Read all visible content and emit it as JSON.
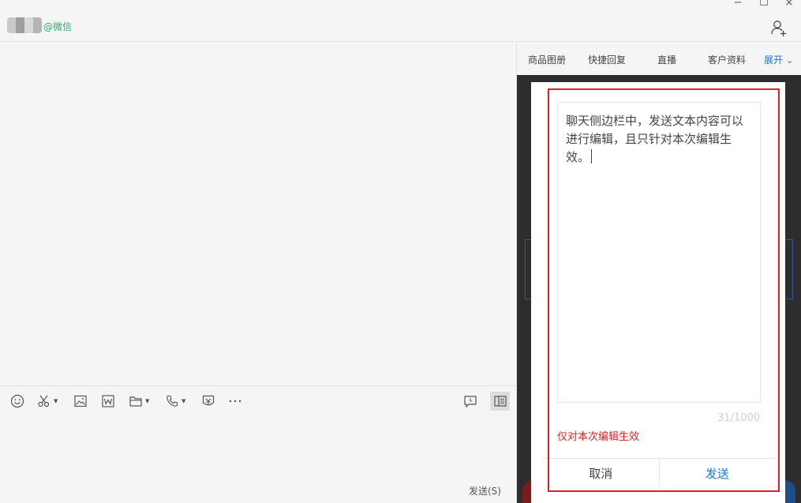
{
  "header": {
    "platform_tag": "@微信",
    "window_controls": {
      "minimize": "−",
      "maximize": "☐",
      "close": "×"
    }
  },
  "toolbar": {
    "icons": [
      "emoji-icon",
      "scissors-icon",
      "image-icon",
      "word-doc-icon",
      "folder-icon",
      "phone-icon",
      "red-packet-icon",
      "more-icon",
      "message-history-icon",
      "sidebar-toggle-icon"
    ],
    "send_label": "发送(S)"
  },
  "sidebar": {
    "tabs": [
      {
        "label": "商品图册"
      },
      {
        "label": "快捷回复"
      },
      {
        "label": "直播"
      },
      {
        "label": "客户资料"
      },
      {
        "label": "展开",
        "active": true
      }
    ],
    "expand_caret": "⌄"
  },
  "edit_modal": {
    "text": "聊天侧边栏中，发送文本内容可以\n进行编辑，且只针对本次编辑生\n效。",
    "counter": "31/1000",
    "hint": "仅对本次编辑生效",
    "cancel_label": "取消",
    "send_label": "发送"
  },
  "colors": {
    "accent": "#1677d9",
    "wechat_green": "#2aae67",
    "highlight_red": "#e02020"
  }
}
